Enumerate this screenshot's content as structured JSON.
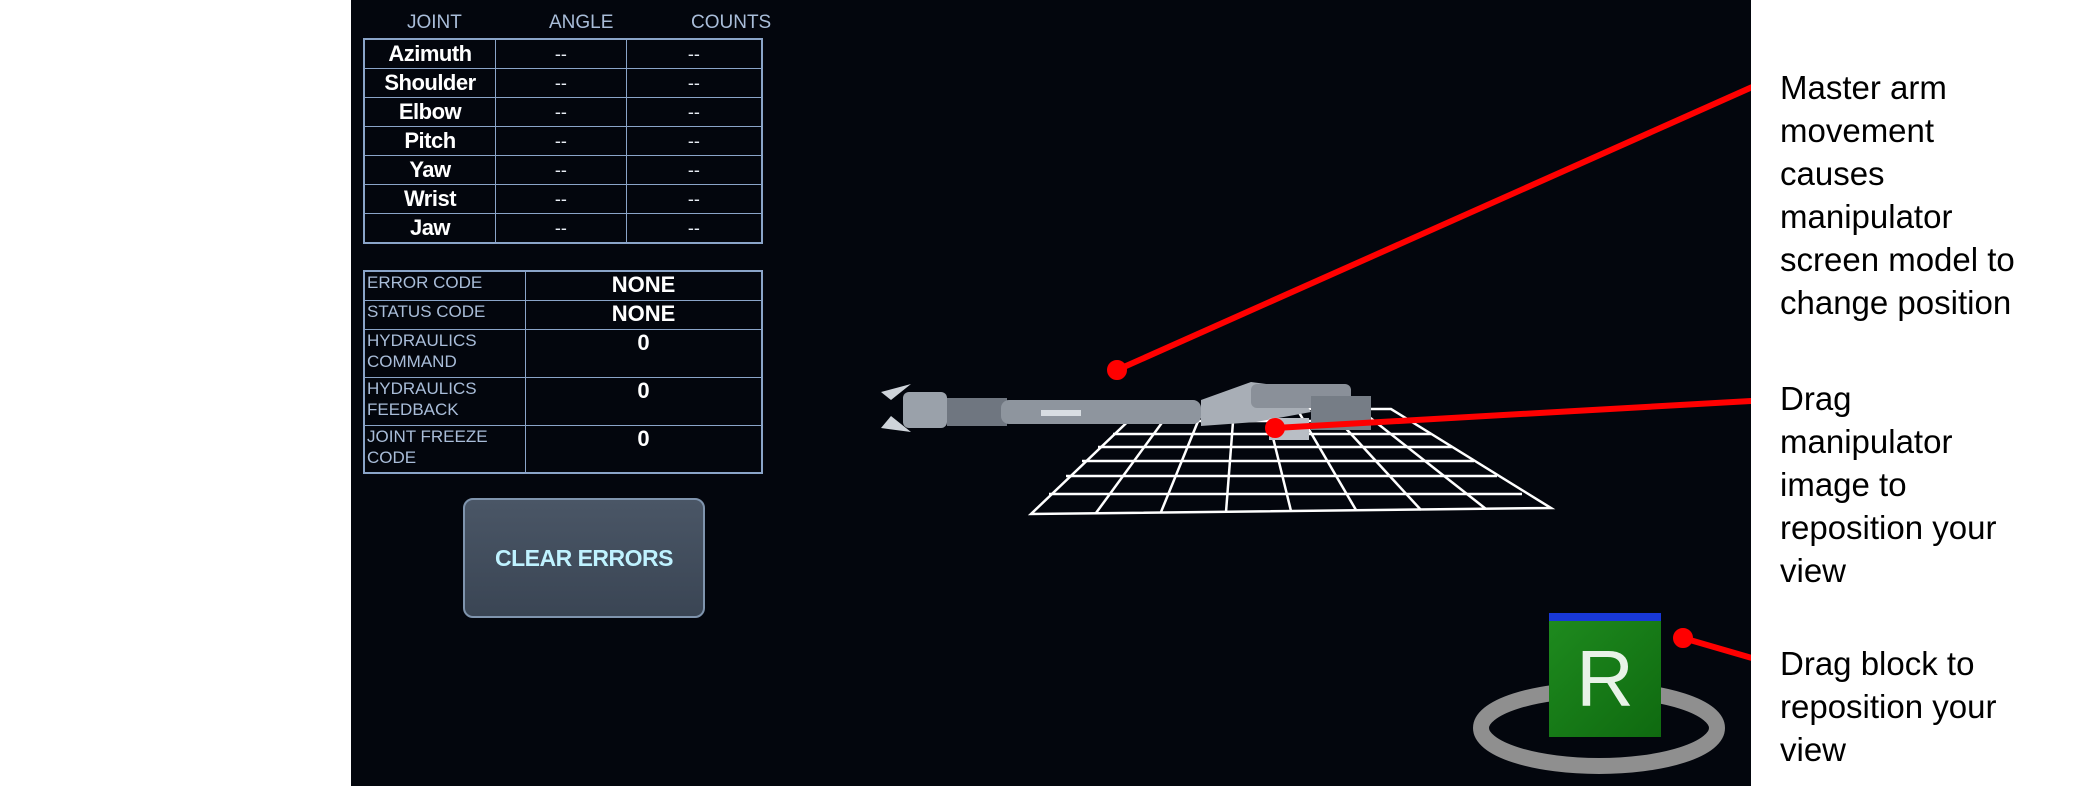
{
  "joint_table": {
    "headers": [
      "JOINT",
      "ANGLE",
      "COUNTS"
    ],
    "rows": [
      {
        "joint": "Azimuth",
        "angle": "--",
        "counts": "--"
      },
      {
        "joint": "Shoulder",
        "angle": "--",
        "counts": "--"
      },
      {
        "joint": "Elbow",
        "angle": "--",
        "counts": "--"
      },
      {
        "joint": "Pitch",
        "angle": "--",
        "counts": "--"
      },
      {
        "joint": "Yaw",
        "angle": "--",
        "counts": "--"
      },
      {
        "joint": "Wrist",
        "angle": "--",
        "counts": "--"
      },
      {
        "joint": "Jaw",
        "angle": "--",
        "counts": "--"
      }
    ]
  },
  "status_table": {
    "rows": [
      {
        "label": "ERROR CODE",
        "value": "NONE"
      },
      {
        "label": "STATUS CODE",
        "value": "NONE"
      },
      {
        "label": "HYDRAULICS\nCOMMAND",
        "value": "0"
      },
      {
        "label": "HYDRAULICS\nFEEDBACK",
        "value": "0"
      },
      {
        "label": "JOINT FREEZE\nCODE",
        "value": "0"
      }
    ]
  },
  "clear_errors_label": "CLEAR ERRORS",
  "nav_cube": {
    "face_letter": "R"
  },
  "annotations": {
    "master_arm": "Master arm\nmovement\ncauses\nmanipulator\nscreen model to\nchange position",
    "drag_manipulator": "Drag\nmanipulator\nimage to\nreposition your\nview",
    "drag_block": "Drag block to\nreposition your\nview"
  },
  "colors": {
    "panel_bg": "#03060d",
    "table_border": "#8aa4c8",
    "button_text": "#bff2ff",
    "pointer_red": "#ff0000",
    "cube_green": "#1e8a1e",
    "cube_top_blue": "#1838d8"
  }
}
